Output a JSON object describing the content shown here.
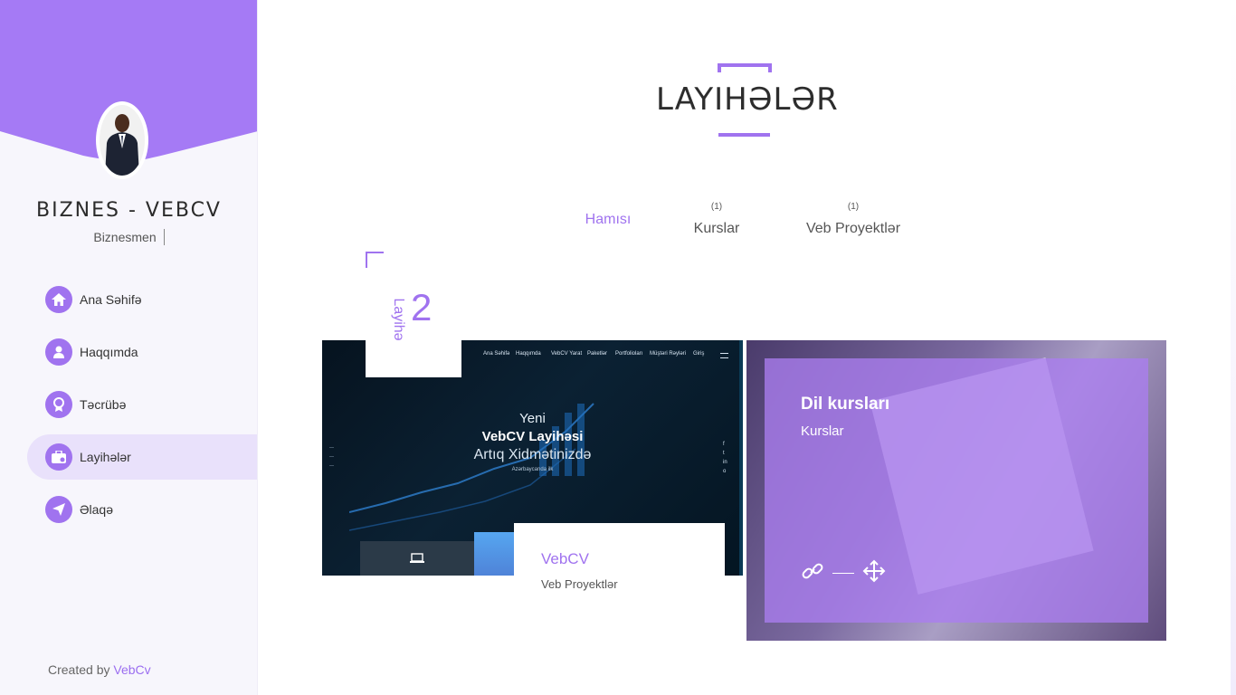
{
  "sidebar": {
    "brand_name": "BIZNES - VEBCV",
    "brand_role": "Biznesmen",
    "items": [
      {
        "label": "Ana Səhifə",
        "icon": "home-icon"
      },
      {
        "label": "Haqqımda",
        "icon": "user-icon"
      },
      {
        "label": "Təcrübə",
        "icon": "award-icon"
      },
      {
        "label": "Layihələr",
        "icon": "briefcase-icon",
        "active": true
      },
      {
        "label": "Əlaqə",
        "icon": "send-icon"
      }
    ],
    "created_prefix": "Created by",
    "created_link": "VebCv"
  },
  "main": {
    "title": "LAYIHƏLƏR",
    "filters": [
      {
        "label": "Hamısı",
        "count": "",
        "active": true
      },
      {
        "label": "Kurslar",
        "count": "(1)"
      },
      {
        "label": "Veb Proyektlər",
        "count": "(1)"
      }
    ],
    "counter": {
      "label": "Layihə",
      "value": "2"
    },
    "projects": [
      {
        "title": "VebCV",
        "category": "Veb Proyektlər",
        "screenshot": {
          "nav": [
            "Ana Səhifə",
            "Haqqımda",
            "VebCV Yarat",
            "Paketlər",
            "Portfolioları",
            "Müştəri Rəyləri",
            "Giriş"
          ],
          "line1": "Yeni",
          "line2": "VebCV Layihəsi",
          "line3": "Artıq Xidmətinizdə",
          "line4": "Azərbaycanda ilk"
        }
      },
      {
        "title": "Dil kursları",
        "category": "Kurslar",
        "actions": [
          "link-icon",
          "move-icon"
        ]
      }
    ]
  },
  "colors": {
    "accent": "#a073ef",
    "sidebar_bg": "#f7f6fc",
    "active_bg": "#e9e1fb"
  }
}
